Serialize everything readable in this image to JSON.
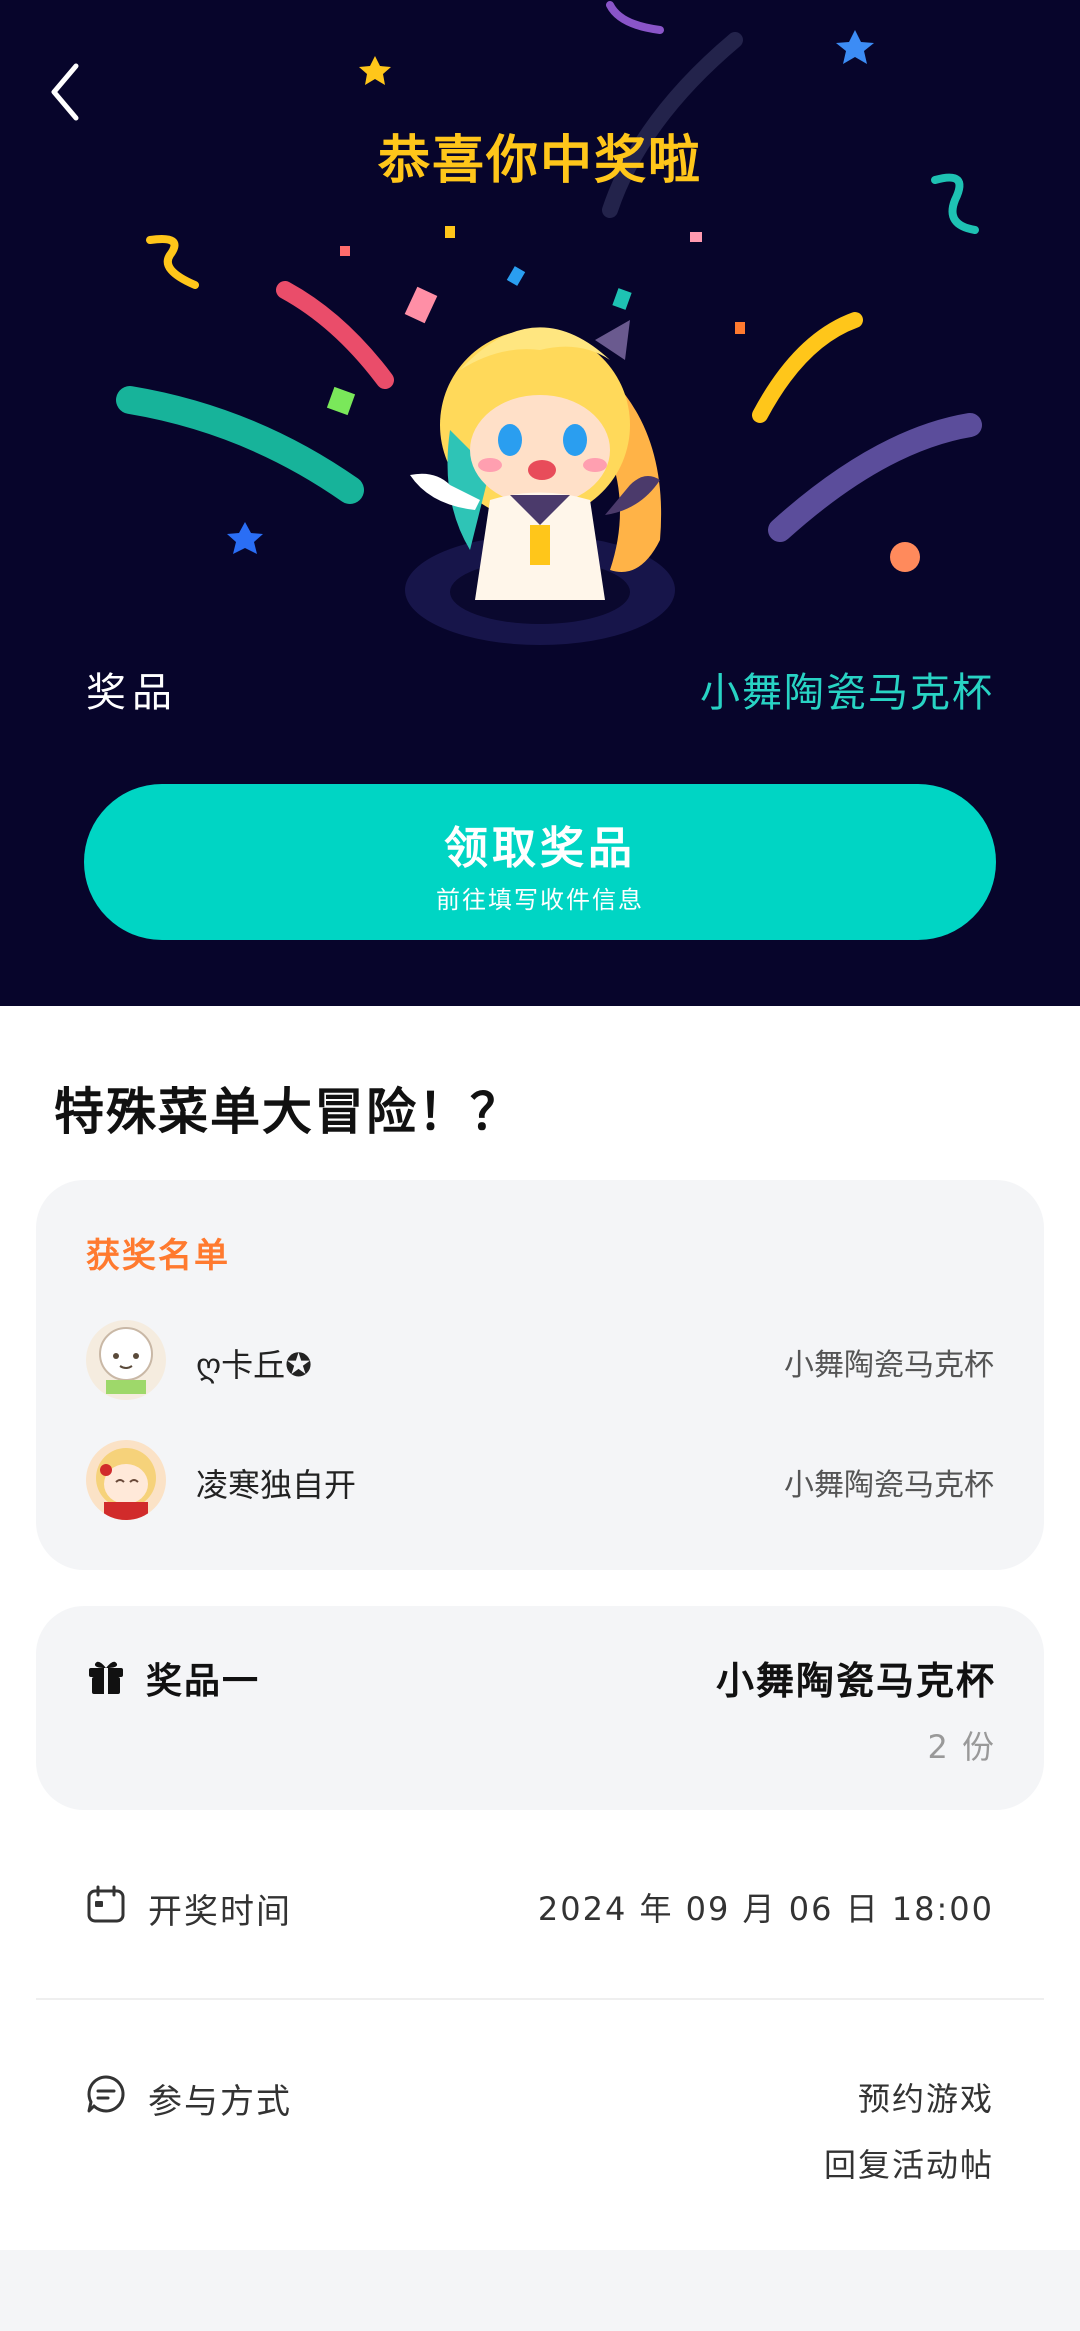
{
  "header": {
    "title": "恭喜你中奖啦",
    "prize_label": "奖品",
    "prize_name": "小舞陶瓷马克杯",
    "claim_button": {
      "label": "领取奖品",
      "sublabel": "前往填写收件信息"
    }
  },
  "event": {
    "title": "特殊菜单大冒险！？"
  },
  "winners": {
    "title": "获奖名单",
    "items": [
      {
        "name": "ღ卡丘✪",
        "prize": "小舞陶瓷马克杯"
      },
      {
        "name": "凌寒独自开",
        "prize": "小舞陶瓷马克杯"
      }
    ]
  },
  "prize_info": {
    "index_label": "奖品一",
    "name": "小舞陶瓷马克杯",
    "count": "2 份"
  },
  "draw_time": {
    "label": "开奖时间",
    "value": "2024 年 09 月 06 日 18:00"
  },
  "participation": {
    "label": "参与方式",
    "methods": [
      "预约游戏",
      "回复活动帖"
    ]
  },
  "colors": {
    "hero_bg": "#07052b",
    "accent": "#00d5c4",
    "title": "#ffc61a",
    "winners_title": "#ff7a2f"
  },
  "icons": [
    "back-arrow-icon",
    "gift-icon",
    "calendar-icon",
    "chat-bubble-icon"
  ]
}
